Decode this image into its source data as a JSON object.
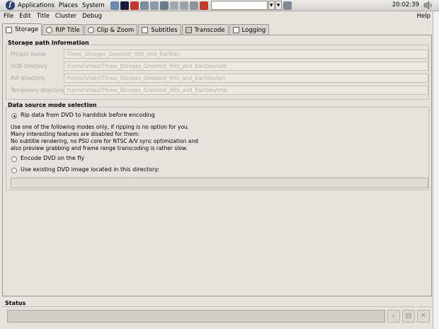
{
  "panel": {
    "menus": [
      "Applications",
      "Places",
      "System"
    ],
    "launchers": [
      {
        "icon": "browser-icon",
        "color": "#6b86b0"
      },
      {
        "icon": "media-icon",
        "color": "#1c1c3a"
      },
      {
        "icon": "help-lifesaver-icon",
        "color": "#c0392b"
      },
      {
        "icon": "network-icon",
        "color": "#7f8c9a"
      },
      {
        "icon": "monitor-icon",
        "color": "#8a9bb0"
      },
      {
        "icon": "mail-icon",
        "color": "#6d7c8c"
      },
      {
        "icon": "drive-icon",
        "color": "#a3a8ae"
      },
      {
        "icon": "device-icon",
        "color": "#9ca3aa"
      },
      {
        "icon": "settings-icon",
        "color": "#8e949b"
      },
      {
        "icon": "question-icon",
        "color": "#c0392b"
      }
    ],
    "clock": "20:02:39"
  },
  "menubar": {
    "items": [
      "File",
      "Edit",
      "Title",
      "Cluster",
      "Debug"
    ],
    "help": "Help"
  },
  "tabs": [
    {
      "label": "Storage",
      "icon": "storage-icon"
    },
    {
      "label": "RIP Title",
      "icon": "disc-icon"
    },
    {
      "label": "Clip & Zoom",
      "icon": "zoom-icon"
    },
    {
      "label": "Subtitles",
      "icon": "subtitles-icon"
    },
    {
      "label": "Transcode",
      "icon": "transcode-icon"
    },
    {
      "label": "Logging",
      "icon": "logging-icon"
    }
  ],
  "storage": {
    "title": "Storage path information",
    "fields": [
      {
        "label": "Project name",
        "value": "Three_Stooges_Greatest_Hits_and_Rarities"
      },
      {
        "label": "VOB directory",
        "value": "/home/Video/Three_Stooges_Greatest_Hits_and_Rarities/vob"
      },
      {
        "label": "AVI directory",
        "value": "/home/Video/Three_Stooges_Greatest_Hits_and_Rarities/avi"
      },
      {
        "label": "Temporary directory",
        "value": "/home/Video/Three_Stooges_Greatest_Hits_and_Rarities/tmp"
      }
    ]
  },
  "source": {
    "title": "Data source mode selection",
    "options": [
      {
        "label": "Rip data from DVD to harddisk before encoding",
        "selected": true
      },
      {
        "label": "Encode DVD on the fly",
        "selected": false
      },
      {
        "label": "Use existing DVD image located in this directory:",
        "selected": false
      }
    ],
    "description": [
      "Use one of the following modes only, if ripping is no option for you.",
      "Many interesting features are disabled for them:",
      "No subtitle rendering, no PSU core for NTSC A/V sync optimization and",
      "also preview grabbing and frame range transcoding is rather slow."
    ],
    "dvd_dir": ""
  },
  "status": {
    "label": "Status",
    "text": ""
  }
}
